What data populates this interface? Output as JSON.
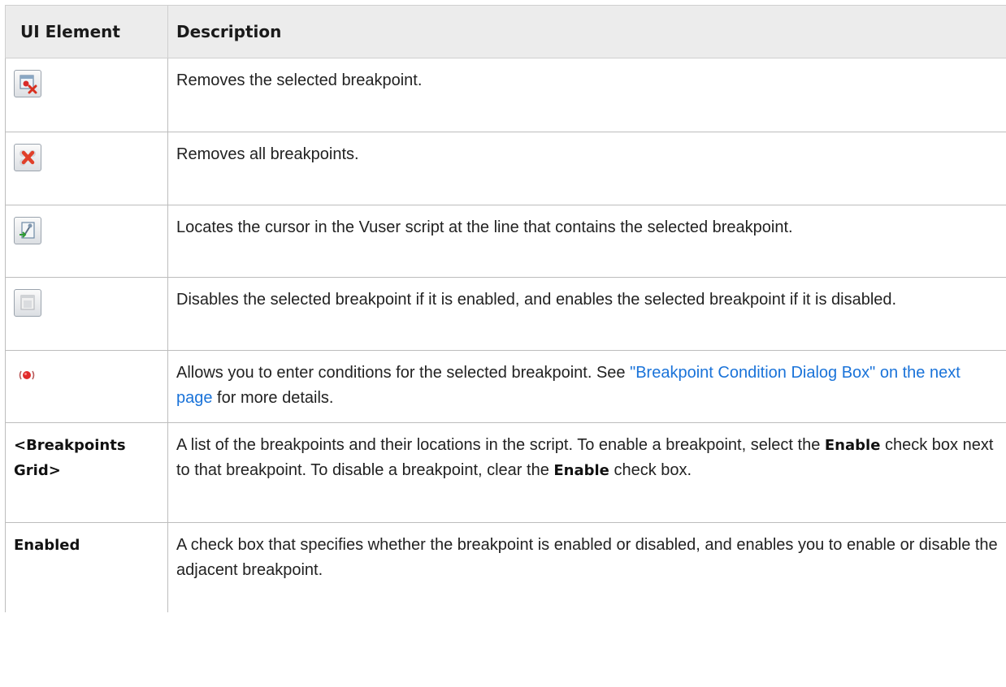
{
  "header": {
    "col1": "UI Element",
    "col2": "Description"
  },
  "rows": [
    {
      "icon": "remove-breakpoint-icon",
      "desc": "Removes the selected breakpoint."
    },
    {
      "icon": "remove-all-breakpoints-icon",
      "desc": "Removes all breakpoints."
    },
    {
      "icon": "goto-source-icon",
      "desc": "Locates the cursor in the Vuser script at the line that contains the selected breakpoint."
    },
    {
      "icon": "toggle-breakpoint-icon",
      "desc": "Disables the selected breakpoint if it is enabled, and enables the selected breakpoint if it is disabled."
    },
    {
      "icon": "breakpoint-condition-icon",
      "desc_pre": "Allows you to enter conditions for the selected breakpoint. See ",
      "link": "\"Breakpoint Condition Dialog Box\" on the next page",
      "desc_post": " for more details."
    },
    {
      "label": "<Breakpoints Grid>",
      "desc_a": "A list of the breakpoints and their locations in the script. To enable a breakpoint, select the ",
      "bold_a": "Enable",
      "desc_b": " check box next to that breakpoint. To disable a breakpoint, clear the ",
      "bold_b": "Enable",
      "desc_c": " check box."
    },
    {
      "label": "Enabled",
      "desc": "A check box that specifies whether the breakpoint is enabled or disabled, and enables you to enable or disable the adjacent breakpoint."
    }
  ]
}
